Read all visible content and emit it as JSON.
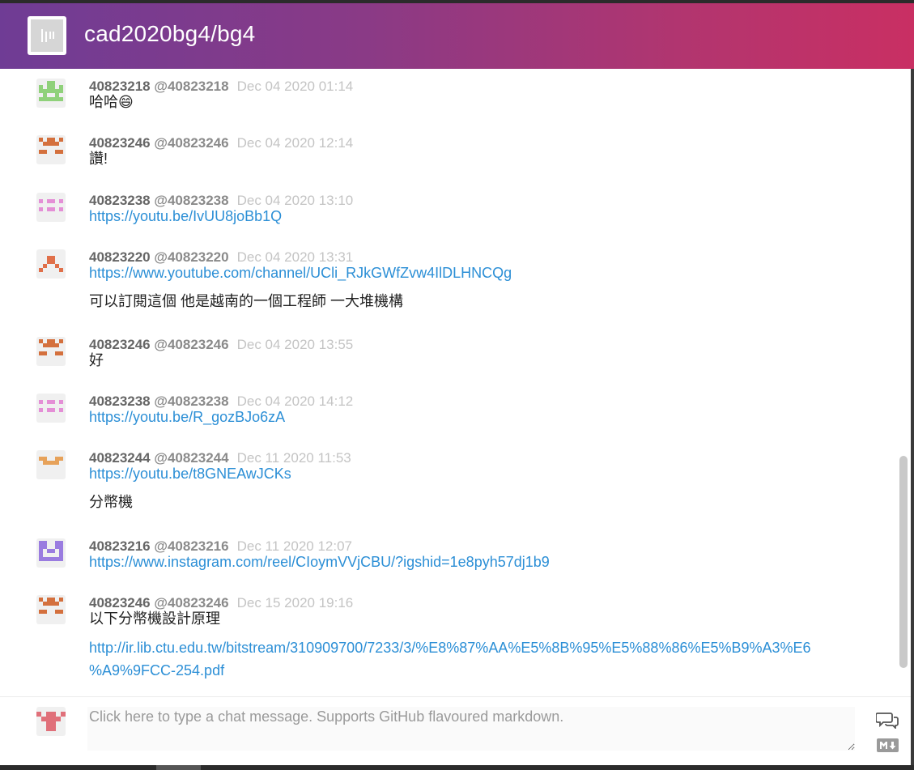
{
  "header": {
    "room_title": "cad2020bg4/bg4",
    "room_avatar_icon": "room-avatar-icon"
  },
  "messages": [
    {
      "user": "40823218",
      "handle": "@40823218",
      "time": "Dec 04 2020 01:14",
      "avatar_color": "#8fd17a",
      "lines": [
        {
          "text": "哈哈😄",
          "link": false
        }
      ]
    },
    {
      "user": "40823246",
      "handle": "@40823246",
      "time": "Dec 04 2020 12:14",
      "avatar_color": "#d4703d",
      "lines": [
        {
          "text": "讚!",
          "link": false
        }
      ]
    },
    {
      "user": "40823238",
      "handle": "@40823238",
      "time": "Dec 04 2020 13:10",
      "avatar_color": "#e48fd6",
      "lines": [
        {
          "text": "https://youtu.be/IvUU8joBb1Q",
          "link": true
        }
      ]
    },
    {
      "user": "40823220",
      "handle": "@40823220",
      "time": "Dec 04 2020 13:31",
      "avatar_color": "#e0704a",
      "lines": [
        {
          "text": "https://www.youtube.com/channel/UCli_RJkGWfZvw4IlDLHNCQg",
          "link": true
        },
        {
          "text": "可以訂閱這個 他是越南的一個工程師 一大堆機構",
          "link": false
        }
      ]
    },
    {
      "user": "40823246",
      "handle": "@40823246",
      "time": "Dec 04 2020 13:55",
      "avatar_color": "#d4703d",
      "lines": [
        {
          "text": "好",
          "link": false
        }
      ]
    },
    {
      "user": "40823238",
      "handle": "@40823238",
      "time": "Dec 04 2020 14:12",
      "avatar_color": "#e48fd6",
      "lines": [
        {
          "text": "https://youtu.be/R_gozBJo6zA",
          "link": true
        }
      ]
    },
    {
      "user": "40823244",
      "handle": "@40823244",
      "time": "Dec 11 2020 11:53",
      "avatar_color": "#e7a25a",
      "lines": [
        {
          "text": "https://youtu.be/t8GNEAwJCKs",
          "link": true
        },
        {
          "text": "分幣機",
          "link": false
        }
      ]
    },
    {
      "user": "40823216",
      "handle": "@40823216",
      "time": "Dec 11 2020 12:07",
      "avatar_color": "#9a7ce0",
      "lines": [
        {
          "text": "https://www.instagram.com/reel/CIoymVVjCBU/?igshid=1e8pyh57dj1b9",
          "link": true
        }
      ]
    },
    {
      "user": "40823246",
      "handle": "@40823246",
      "time": "Dec 15 2020 19:16",
      "avatar_color": "#d4703d",
      "lines": [
        {
          "text": "以下分幣機設計原理",
          "link": false
        },
        {
          "text": "http://ir.lib.ctu.edu.tw/bitstream/310909700/7233/3/%E8%87%AA%E5%8B%95%E5%88%86%E5%B9%A3%E6",
          "link": true
        },
        {
          "text": "%A9%9FCC-254.pdf",
          "link": true
        }
      ]
    }
  ],
  "composer": {
    "placeholder": "Click here to type a chat message. Supports GitHub flavoured markdown.",
    "avatar_color": "#e0707a",
    "chat_icon": "chat-bubbles-icon",
    "markdown_icon": "markdown-icon"
  }
}
